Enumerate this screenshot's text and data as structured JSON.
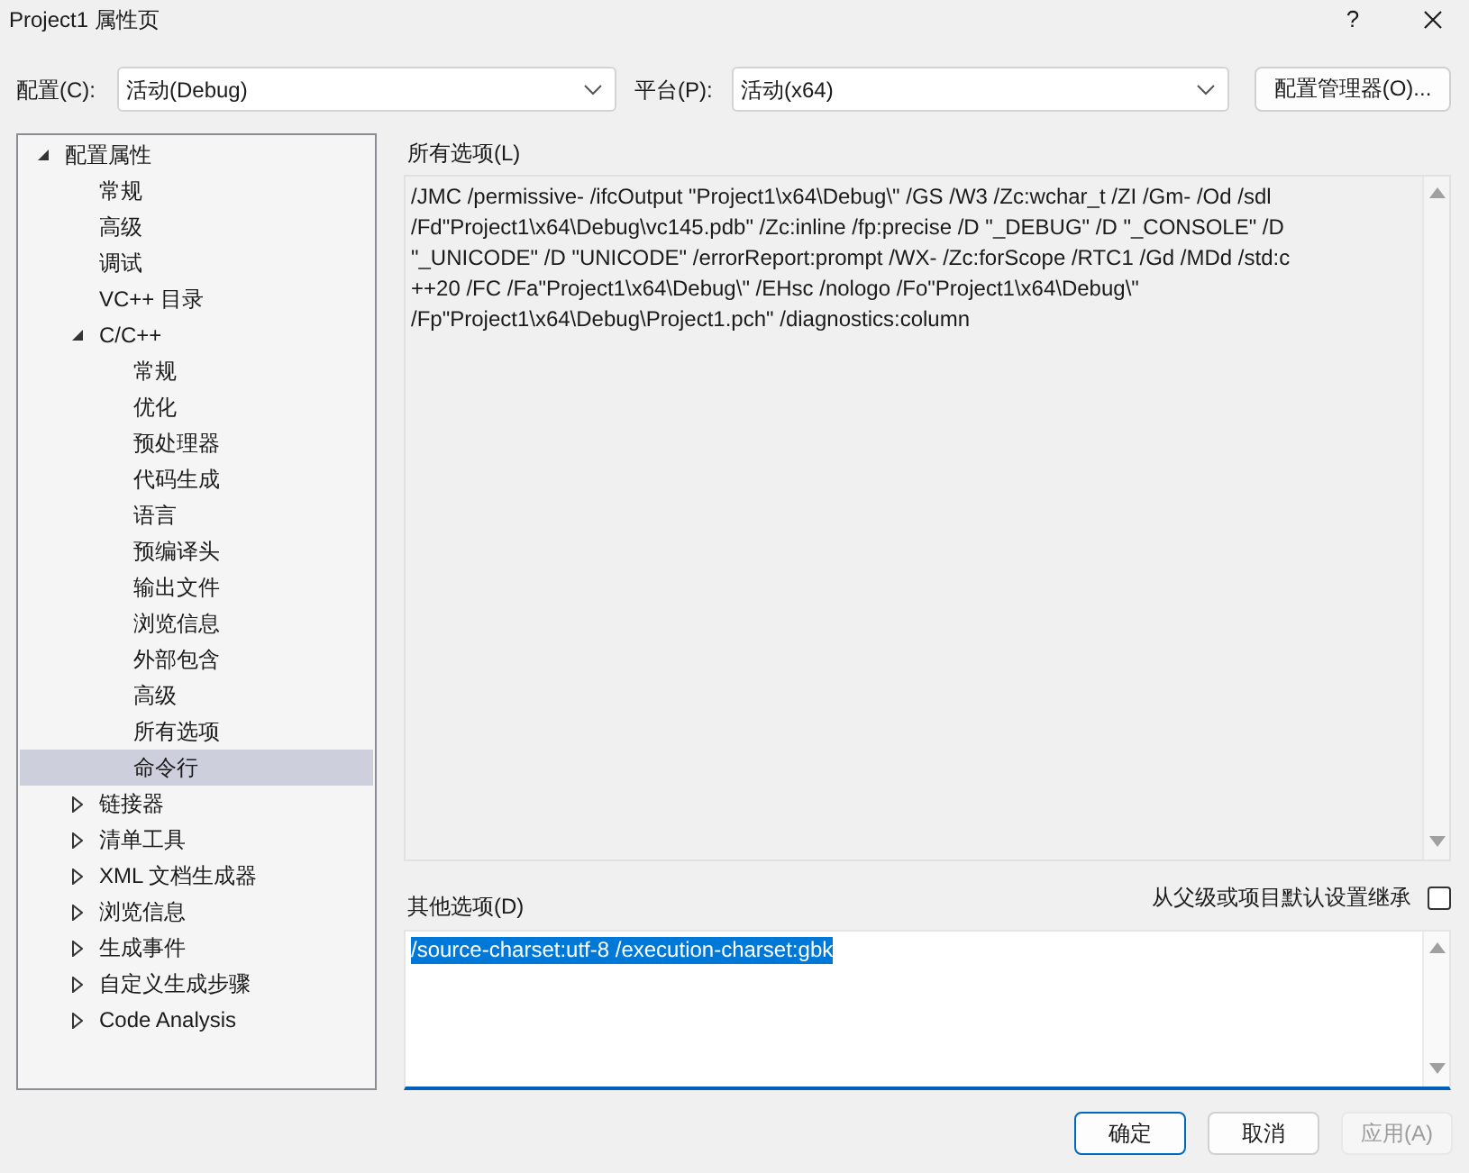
{
  "window": {
    "title": "Project1 属性页",
    "help": "?"
  },
  "toolbar": {
    "configuration": {
      "label": "配置(C):",
      "value": "活动(Debug)"
    },
    "platform": {
      "label": "平台(P):",
      "value": "活动(x64)"
    },
    "manager_button": "配置管理器(O)..."
  },
  "tree": [
    {
      "label": "配置属性",
      "expanded": true,
      "selected": false,
      "children": [
        {
          "label": "常规",
          "selected": false
        },
        {
          "label": "高级",
          "selected": false
        },
        {
          "label": "调试",
          "selected": false
        },
        {
          "label": "VC++ 目录",
          "selected": false
        },
        {
          "label": "C/C++",
          "expanded": true,
          "selected": false,
          "children": [
            {
              "label": "常规",
              "selected": false
            },
            {
              "label": "优化",
              "selected": false
            },
            {
              "label": "预处理器",
              "selected": false
            },
            {
              "label": "代码生成",
              "selected": false
            },
            {
              "label": "语言",
              "selected": false
            },
            {
              "label": "预编译头",
              "selected": false
            },
            {
              "label": "输出文件",
              "selected": false
            },
            {
              "label": "浏览信息",
              "selected": false
            },
            {
              "label": "外部包含",
              "selected": false
            },
            {
              "label": "高级",
              "selected": false
            },
            {
              "label": "所有选项",
              "selected": false
            },
            {
              "label": "命令行",
              "selected": true
            }
          ]
        },
        {
          "label": "链接器",
          "expanded": false,
          "selected": false
        },
        {
          "label": "清单工具",
          "expanded": false,
          "selected": false
        },
        {
          "label": "XML 文档生成器",
          "expanded": false,
          "selected": false
        },
        {
          "label": "浏览信息",
          "expanded": false,
          "selected": false
        },
        {
          "label": "生成事件",
          "expanded": false,
          "selected": false
        },
        {
          "label": "自定义生成步骤",
          "expanded": false,
          "selected": false
        },
        {
          "label": "Code Analysis",
          "expanded": false,
          "selected": false
        }
      ]
    }
  ],
  "all_options": {
    "label": "所有选项(L)",
    "lines": [
      "/JMC /permissive- /ifcOutput \"Project1\\x64\\Debug\\\" /GS /W3 /Zc:wchar_t /ZI /Gm- /Od /sdl",
      "/Fd\"Project1\\x64\\Debug\\vc145.pdb\" /Zc:inline /fp:precise /D \"_DEBUG\" /D \"_CONSOLE\" /D",
      "\"_UNICODE\" /D \"UNICODE\" /errorReport:prompt /WX- /Zc:forScope /RTC1 /Gd /MDd /std:c",
      "++20 /FC /Fa\"Project1\\x64\\Debug\\\" /EHsc /nologo /Fo\"Project1\\x64\\Debug\\\"",
      "/Fp\"Project1\\x64\\Debug\\Project1.pch\" /diagnostics:column"
    ]
  },
  "additional_options": {
    "label": "其他选项(D)",
    "value": "/source-charset:utf-8 /execution-charset:gbk",
    "selected": true
  },
  "inherit": {
    "label": "从父级或项目默认设置继承",
    "checked": false
  },
  "buttons": [
    {
      "label": "确定",
      "default": true,
      "disabled": false
    },
    {
      "label": "取消",
      "default": false,
      "disabled": false
    },
    {
      "label": "应用(A)",
      "default": false,
      "disabled": true
    }
  ]
}
